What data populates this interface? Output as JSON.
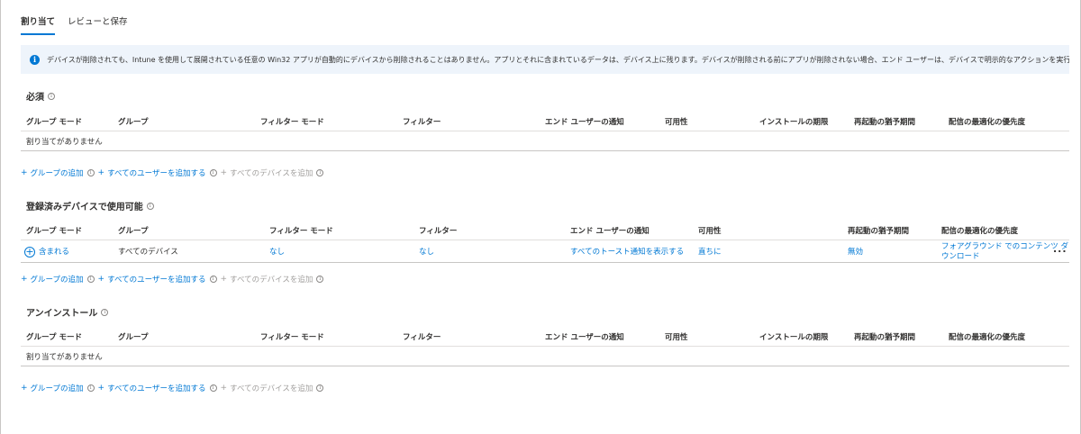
{
  "tabs": [
    {
      "label": "割り当て",
      "active": true
    },
    {
      "label": "レビューと保存",
      "active": false
    }
  ],
  "banner": {
    "icon": "info-icon",
    "text": "デバイスが削除されても、Intune を使用して展開されている任意の Win32 アプリが自動的にデバイスから削除されることはありません。アプリとそれに含まれているデータは、デバイス上に残ります。デバイスが削除される前にアプリが削除されない場合、エンド ユーザーは、デバイスで明示的なアクションを実行してアプリを削除する必要があります。"
  },
  "required": {
    "title": "必須",
    "headers": [
      "グループ モード",
      "グループ",
      "フィルター モード",
      "フィルター",
      "エンド ユーザーの通知",
      "可用性",
      "インストールの期限",
      "再起動の猶予期間",
      "配信の最適化の優先度"
    ],
    "empty": "割り当てがありません",
    "actions": [
      "グループの追加",
      "すべてのユーザーを追加する",
      "すべてのデバイスを追加"
    ]
  },
  "available": {
    "title": "登録済みデバイスで使用可能",
    "headers": [
      "グループ モード",
      "グループ",
      "フィルター モード",
      "フィルター",
      "エンド ユーザーの通知",
      "可用性",
      "再起動の猶予期間",
      "配信の最適化の優先度"
    ],
    "row": {
      "mode": "含まれる",
      "group": "すべてのデバイス",
      "filter_mode": "なし",
      "filter": "なし",
      "notification": "すべてのトースト通知を表示する",
      "availability": "直ちに",
      "grace": "無効",
      "priority_line1": "フォアグラウンド でのコンテンツ ダ",
      "priority_line2": "ウンロード",
      "more": "..."
    },
    "actions": [
      "グループの追加",
      "すべてのユーザーを追加する",
      "すべてのデバイスを追加"
    ]
  },
  "uninstall": {
    "title": "アンインストール",
    "headers": [
      "グループ モード",
      "グループ",
      "フィルター モード",
      "フィルター",
      "エンド ユーザーの通知",
      "可用性",
      "インストールの期限",
      "再起動の猶予期間",
      "配信の最適化の優先度"
    ],
    "empty": "割り当てがありません",
    "actions": [
      "グループの追加",
      "すべてのユーザーを追加する",
      "すべてのデバイスを追加"
    ]
  },
  "colors": {
    "accent": "#0078d4",
    "banner_bg": "#eef4fb",
    "disabled": "#a19f9d"
  }
}
